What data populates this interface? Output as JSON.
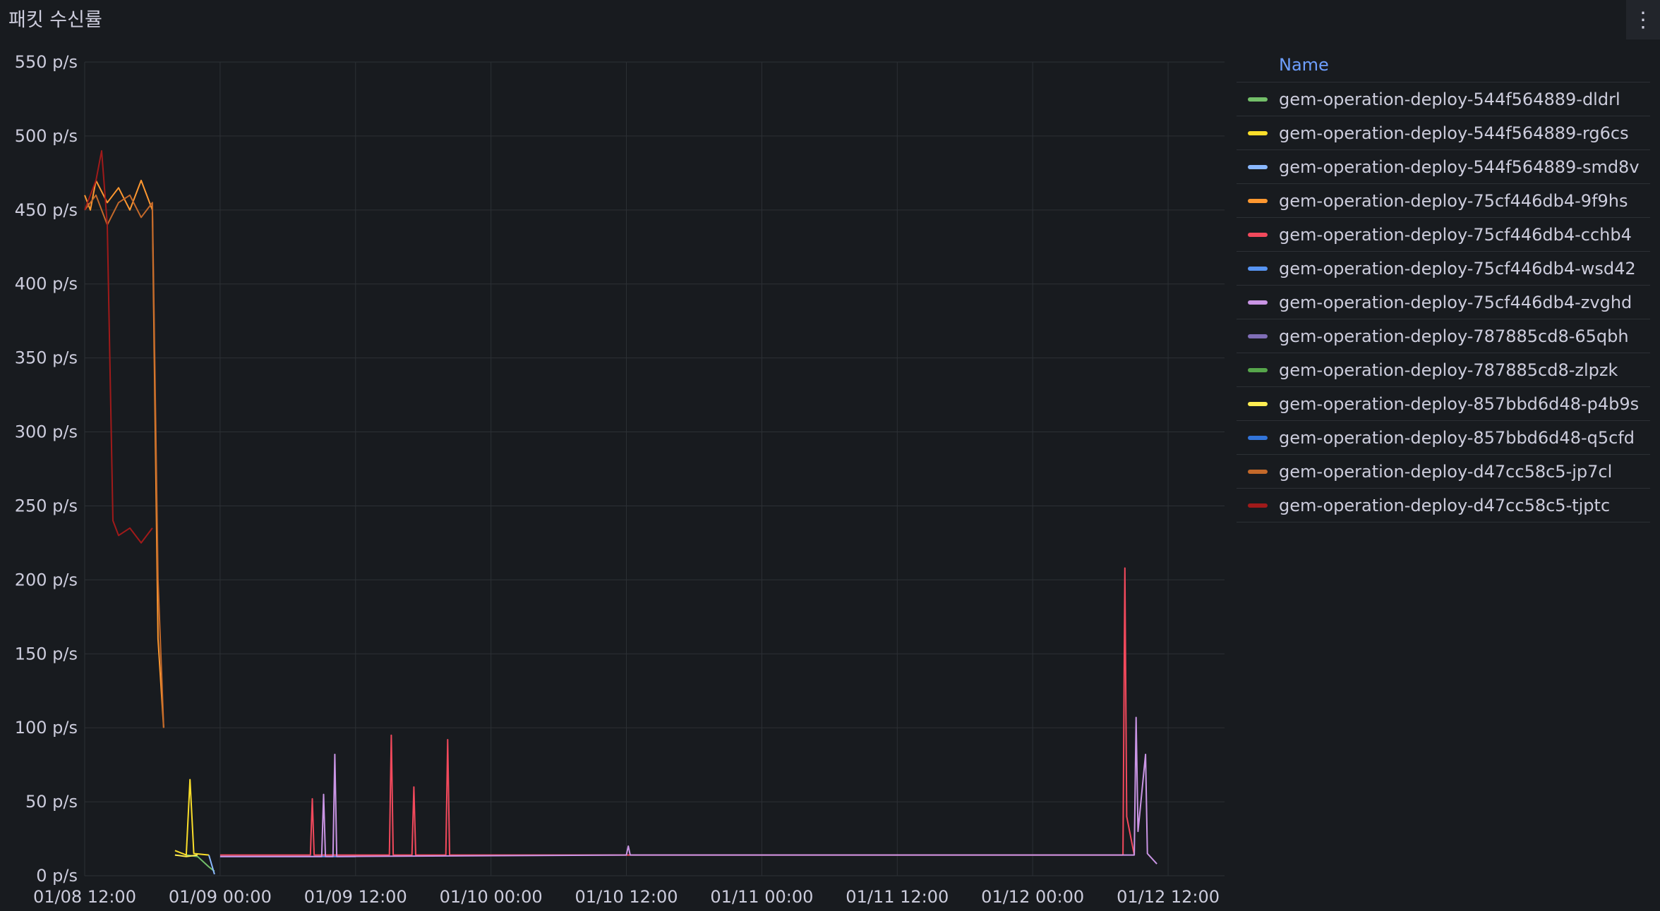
{
  "panel": {
    "title": "패킷 수신률",
    "menu_icon": "vertical-ellipsis-icon"
  },
  "legend": {
    "header": "Name"
  },
  "chart_data": {
    "type": "line",
    "title": "패킷 수신률",
    "xlabel": "",
    "ylabel": "",
    "x_axis": {
      "type": "time",
      "range": [
        "01/08 12:00",
        "01/12 17:00"
      ],
      "tick_labels": [
        "01/08 12:00",
        "01/09 00:00",
        "01/09 12:00",
        "01/10 00:00",
        "01/10 12:00",
        "01/11 00:00",
        "01/11 12:00",
        "01/12 00:00",
        "01/12 12:00"
      ]
    },
    "y_axis": {
      "unit": "p/s",
      "range": [
        0,
        550
      ],
      "tick_labels": [
        "0 p/s",
        "50 p/s",
        "100 p/s",
        "150 p/s",
        "200 p/s",
        "250 p/s",
        "300 p/s",
        "350 p/s",
        "400 p/s",
        "450 p/s",
        "500 p/s",
        "550 p/s"
      ],
      "tick_values": [
        0,
        50,
        100,
        150,
        200,
        250,
        300,
        350,
        400,
        450,
        500,
        550
      ]
    },
    "grid": true,
    "legend_position": "right",
    "series": [
      {
        "name": "gem-operation-deploy-544f564889-dldrl",
        "color": "#73bf69",
        "points": [
          [
            "01/08 21:00",
            14
          ],
          [
            "01/08 22:00",
            13
          ],
          [
            "01/08 23:00",
            6
          ],
          [
            "01/08 23:30",
            3
          ]
        ]
      },
      {
        "name": "gem-operation-deploy-544f564889-rg6cs",
        "color": "#fade2a",
        "points": [
          [
            "01/08 20:00",
            17
          ],
          [
            "01/08 21:00",
            14
          ],
          [
            "01/08 21:20",
            65
          ],
          [
            "01/08 21:40",
            15
          ],
          [
            "01/08 23:00",
            14
          ]
        ]
      },
      {
        "name": "gem-operation-deploy-544f564889-smd8v",
        "color": "#8ab8ff",
        "points": [
          [
            "01/08 23:00",
            14
          ],
          [
            "01/08 23:30",
            1
          ]
        ]
      },
      {
        "name": "gem-operation-deploy-75cf446db4-9f9hs",
        "color": "#ff9830",
        "points": [
          [
            "01/08 12:00",
            460
          ],
          [
            "01/08 12:30",
            450
          ],
          [
            "01/08 13:00",
            470
          ],
          [
            "01/08 14:00",
            455
          ],
          [
            "01/08 15:00",
            465
          ],
          [
            "01/08 16:00",
            450
          ],
          [
            "01/08 17:00",
            470
          ],
          [
            "01/08 18:00",
            450
          ],
          [
            "01/08 18:30",
            160
          ],
          [
            "01/08 19:00",
            100
          ]
        ]
      },
      {
        "name": "gem-operation-deploy-75cf446db4-cchb4",
        "color": "#f2495c",
        "points": [
          [
            "01/09 00:00",
            14
          ],
          [
            "01/09 08:00",
            14
          ],
          [
            "01/09 08:10",
            52
          ],
          [
            "01/09 08:20",
            14
          ],
          [
            "01/09 15:00",
            14
          ],
          [
            "01/09 15:10",
            95
          ],
          [
            "01/09 15:20",
            14
          ],
          [
            "01/09 17:00",
            14
          ],
          [
            "01/09 17:10",
            60
          ],
          [
            "01/09 17:20",
            14
          ],
          [
            "01/09 20:00",
            14
          ],
          [
            "01/09 20:10",
            92
          ],
          [
            "01/09 20:20",
            14
          ],
          [
            "01/12 00:00",
            14
          ],
          [
            "01/12 08:00",
            14
          ],
          [
            "01/12 08:10",
            208
          ],
          [
            "01/12 08:20",
            40
          ],
          [
            "01/12 09:00",
            14
          ]
        ]
      },
      {
        "name": "gem-operation-deploy-75cf446db4-wsd42",
        "color": "#5794f2",
        "points": [
          [
            "01/09 00:00",
            13
          ],
          [
            "01/09 12:00",
            13
          ]
        ]
      },
      {
        "name": "gem-operation-deploy-75cf446db4-zvghd",
        "color": "#ca95e5",
        "points": [
          [
            "01/09 00:00",
            13
          ],
          [
            "01/09 09:00",
            13
          ],
          [
            "01/09 09:10",
            55
          ],
          [
            "01/09 09:20",
            13
          ],
          [
            "01/09 10:00",
            13
          ],
          [
            "01/09 10:10",
            82
          ],
          [
            "01/09 10:20",
            13
          ],
          [
            "01/10 12:00",
            14
          ],
          [
            "01/10 12:10",
            20
          ],
          [
            "01/10 12:20",
            14
          ],
          [
            "01/12 09:00",
            14
          ],
          [
            "01/12 09:10",
            107
          ],
          [
            "01/12 09:20",
            30
          ],
          [
            "01/12 10:00",
            82
          ],
          [
            "01/12 10:10",
            15
          ],
          [
            "01/12 11:00",
            8
          ]
        ]
      },
      {
        "name": "gem-operation-deploy-787885cd8-65qbh",
        "color": "#806eb7",
        "points": []
      },
      {
        "name": "gem-operation-deploy-787885cd8-zlpzk",
        "color": "#56a64b",
        "points": []
      },
      {
        "name": "gem-operation-deploy-857bbd6d48-p4b9s",
        "color": "#ffee52",
        "points": [
          [
            "01/08 20:00",
            14
          ],
          [
            "01/08 21:00",
            13
          ],
          [
            "01/08 22:00",
            14
          ]
        ]
      },
      {
        "name": "gem-operation-deploy-857bbd6d48-q5cfd",
        "color": "#3274d9",
        "points": [
          [
            "01/08 23:00",
            2
          ]
        ]
      },
      {
        "name": "gem-operation-deploy-d47cc58c5-jp7cl",
        "color": "#c4692a",
        "points": [
          [
            "01/08 12:00",
            450
          ],
          [
            "01/08 13:00",
            460
          ],
          [
            "01/08 14:00",
            440
          ],
          [
            "01/08 15:00",
            455
          ],
          [
            "01/08 16:00",
            460
          ],
          [
            "01/08 17:00",
            445
          ],
          [
            "01/08 18:00",
            455
          ],
          [
            "01/08 18:30",
            200
          ],
          [
            "01/08 19:00",
            100
          ]
        ]
      },
      {
        "name": "gem-operation-deploy-d47cc58c5-tjptc",
        "color": "#a01a1a",
        "points": [
          [
            "01/08 12:00",
            450
          ],
          [
            "01/08 13:00",
            470
          ],
          [
            "01/08 13:30",
            490
          ],
          [
            "01/08 14:00",
            440
          ],
          [
            "01/08 14:30",
            240
          ],
          [
            "01/08 15:00",
            230
          ],
          [
            "01/08 16:00",
            235
          ],
          [
            "01/08 17:00",
            225
          ],
          [
            "01/08 18:00",
            235
          ]
        ]
      }
    ]
  }
}
